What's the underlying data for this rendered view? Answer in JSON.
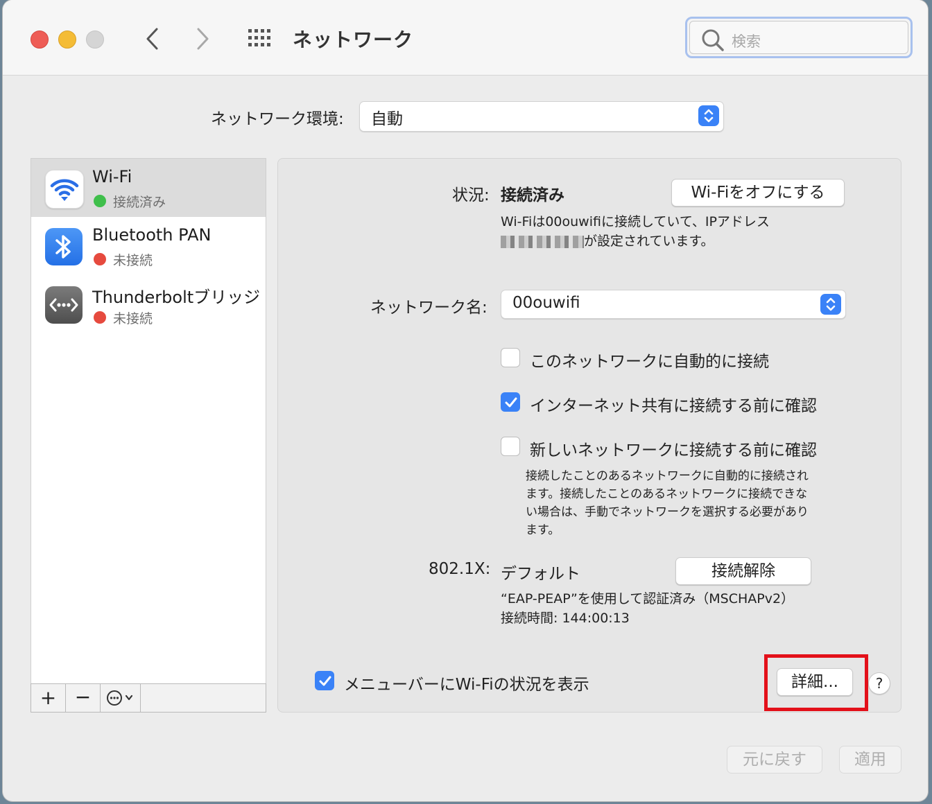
{
  "window": {
    "title": "ネットワーク",
    "search_placeholder": "検索"
  },
  "location": {
    "label": "ネットワーク環境:",
    "value": "自動"
  },
  "services": [
    {
      "name": "Wi-Fi",
      "status": "接続済み",
      "status_color": "#3fbf4b",
      "icon": "wifi-icon",
      "selected": true
    },
    {
      "name": "Bluetooth PAN",
      "status": "未接続",
      "status_color": "#e64a3e",
      "icon": "bluetooth-icon",
      "selected": false
    },
    {
      "name": "Thunderboltブリッジ",
      "status": "未接続",
      "status_color": "#e64a3e",
      "icon": "thunderbolt-bridge-icon",
      "selected": false
    }
  ],
  "sidebar_toolbar": {
    "add": "+",
    "remove": "−"
  },
  "detail": {
    "status_label": "状況:",
    "status_value": "接続済み",
    "wifi_off_button": "Wi-Fiをオフにする",
    "status_desc_line1": "Wi-Fiは00ouwifiに接続していて、IPアドレス",
    "status_desc_line2_suffix": "が設定されています。",
    "network_name_label": "ネットワーク名:",
    "network_name_value": "00ouwifi",
    "cb_auto_join": "このネットワークに自動的に接続",
    "cb_auto_join_checked": false,
    "cb_ask_hotspot": "インターネット共有に接続する前に確認",
    "cb_ask_hotspot_checked": true,
    "cb_ask_new": "新しいネットワークに接続する前に確認",
    "cb_ask_new_checked": false,
    "help_text_l1": "接続したことのあるネットワークに自動的に接続され",
    "help_text_l2": "ます。接続したことのあるネットワークに接続できな",
    "help_text_l3": "い場合は、手動でネットワークを選択する必要があり",
    "help_text_l4": "ます。",
    "dot1x_label": "802.1X:",
    "dot1x_value": "デフォルト",
    "disconnect_button": "接続解除",
    "dot1x_auth": "“EAP-PEAP”を使用して認証済み（MSCHAPv2）",
    "connect_time": "接続時間: 144:00:13",
    "show_menubar": "メニューバーにWi-Fiの状況を表示",
    "show_menubar_checked": true,
    "advanced_button": "詳細...",
    "help_button": "?"
  },
  "footer": {
    "revert": "元に戻す",
    "apply": "適用"
  }
}
